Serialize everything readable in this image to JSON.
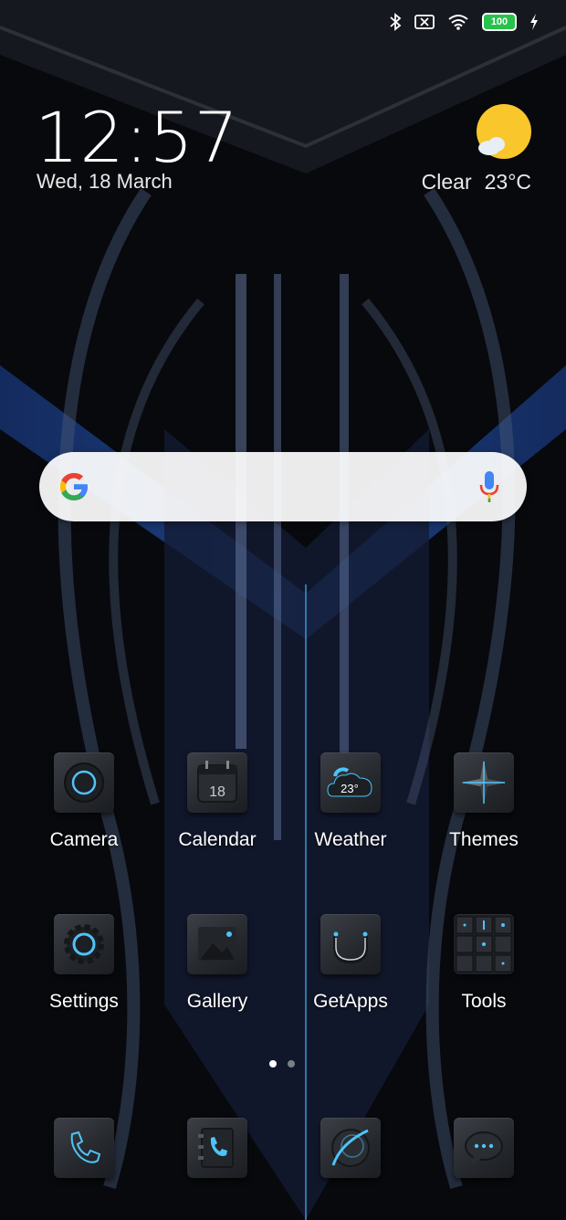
{
  "status_bar": {
    "icons": [
      "bluetooth-icon",
      "no-sim-icon",
      "wifi-icon",
      "battery-icon",
      "charging-icon"
    ],
    "battery_level": "100"
  },
  "lockscreen_widget": {
    "time": "12:57",
    "date": "Wed, 18 March"
  },
  "weather_widget": {
    "condition": "Clear",
    "temperature": "23°C",
    "icon": "sun-cloud-icon"
  },
  "search_bar": {
    "logo": "google-logo-icon",
    "mic": "mic-icon"
  },
  "apps": [
    {
      "label": "Camera",
      "icon": "camera-icon"
    },
    {
      "label": "Calendar",
      "icon": "calendar-icon",
      "badge": "18"
    },
    {
      "label": "Weather",
      "icon": "weather-icon",
      "badge": "23°"
    },
    {
      "label": "Themes",
      "icon": "themes-icon"
    },
    {
      "label": "Settings",
      "icon": "gear-icon"
    },
    {
      "label": "Gallery",
      "icon": "gallery-icon"
    },
    {
      "label": "GetApps",
      "icon": "getapps-icon"
    },
    {
      "label": "Tools",
      "icon": "tools-folder-icon"
    }
  ],
  "page_indicator": {
    "pages": 2,
    "active": 1
  },
  "dock": [
    {
      "icon": "phone-icon"
    },
    {
      "icon": "contacts-icon"
    },
    {
      "icon": "browser-icon"
    },
    {
      "icon": "messages-icon"
    }
  ],
  "colors": {
    "accent": "#4fc3f7",
    "battery": "#27c24c",
    "sun": "#f9c62b"
  }
}
